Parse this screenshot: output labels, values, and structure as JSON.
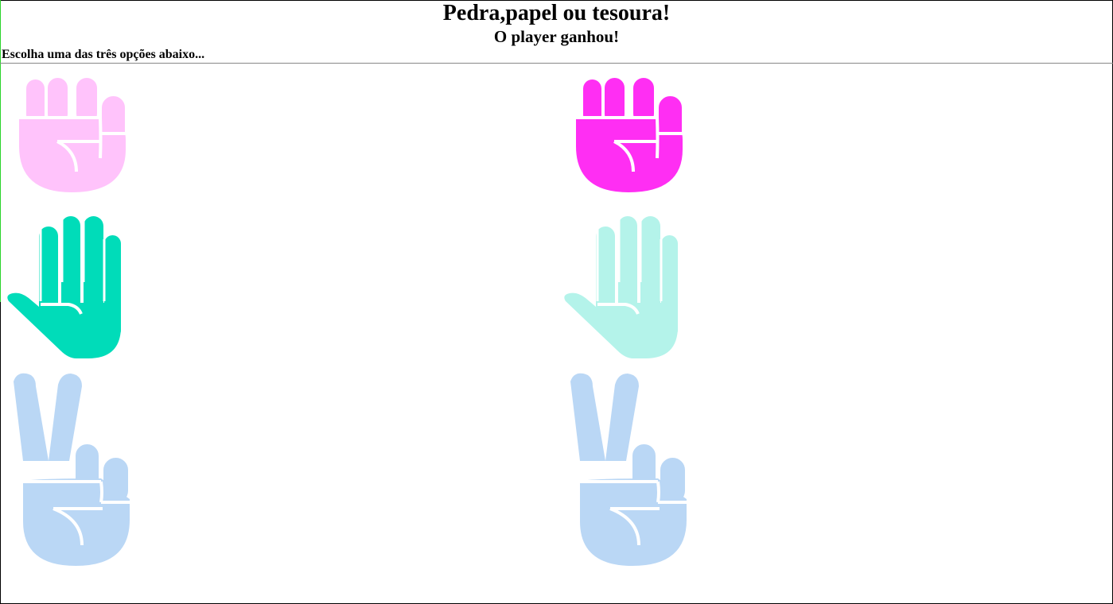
{
  "header": {
    "title": "Pedra,papel ou tesoura!",
    "result": "O player ganhou!",
    "instruction": "Escolha uma das três opções abaixo..."
  },
  "colors": {
    "rock_faded": "#ffc3fb",
    "rock_active": "#ff2ef3",
    "paper_active": "#00dcb9",
    "paper_faded": "#b4f3ea",
    "scissors": "#bad7f5",
    "outline": "#ffffff",
    "accent_line": "#2bd32b"
  },
  "player_choices": [
    {
      "name": "pedra",
      "icon": "rock-fist-icon",
      "state": "faded"
    },
    {
      "name": "papel",
      "icon": "paper-open-hand-icon",
      "state": "selected"
    },
    {
      "name": "tesoura",
      "icon": "scissors-peace-hand-icon",
      "state": "faded"
    }
  ],
  "computer_choices": [
    {
      "name": "pedra",
      "icon": "rock-fist-icon",
      "state": "selected"
    },
    {
      "name": "papel",
      "icon": "paper-open-hand-icon",
      "state": "faded"
    },
    {
      "name": "tesoura",
      "icon": "scissors-peace-hand-icon",
      "state": "faded"
    }
  ]
}
